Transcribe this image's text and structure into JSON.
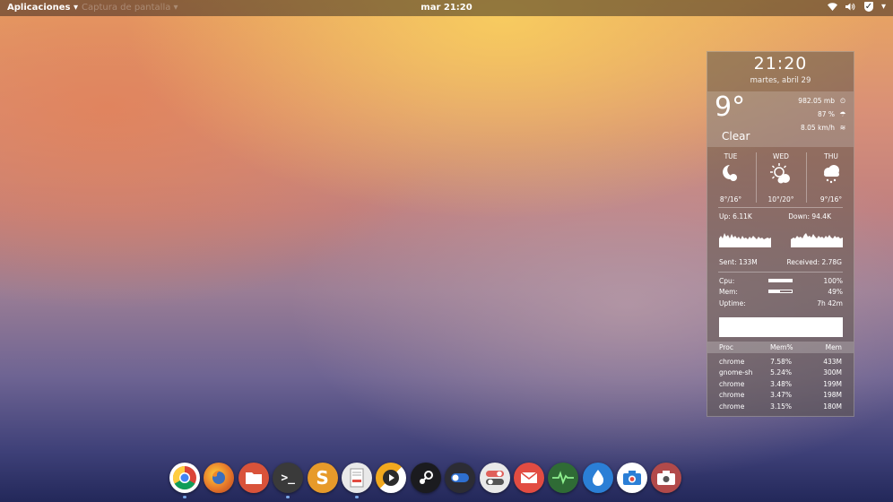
{
  "topbar": {
    "apps_menu": "Aplicaciones ▾",
    "capture_menu": "Captura de pantalla ▾",
    "clock": "mar 21:20",
    "tray_icons": [
      "wifi-icon",
      "volume-icon",
      "shield-check-icon",
      "chevron-down-icon"
    ]
  },
  "conky": {
    "time": "21:20",
    "date": "martes, abril 29",
    "weather": {
      "temp": "9°",
      "condition": "Clear",
      "pressure": "982.05 mb",
      "humidity": "87 %",
      "wind": "8.05 km/h",
      "forecast": [
        {
          "day": "TUE",
          "icon": "moon-cloud-icon",
          "range": "8°/16°"
        },
        {
          "day": "WED",
          "icon": "sun-cloud-icon",
          "range": "10°/20°"
        },
        {
          "day": "THU",
          "icon": "rain-cloud-icon",
          "range": "9°/16°"
        }
      ]
    },
    "network": {
      "up": "Up: 6.11K",
      "down": "Down: 94.4K",
      "sent": "Sent: 133M",
      "received": "Received: 2.78G"
    },
    "system": {
      "cpu_label": "Cpu:",
      "cpu_value": "100%",
      "cpu_fraction": 1.0,
      "mem_label": "Mem:",
      "mem_value": "49%",
      "mem_fraction": 0.49,
      "uptime_label": "Uptime:",
      "uptime_value": "7h 42m"
    },
    "processes": {
      "headers": [
        "Proc",
        "Mem%",
        "Mem"
      ],
      "rows": [
        [
          "chrome",
          "7.58%",
          "433M"
        ],
        [
          "gnome-sh",
          "5.24%",
          "300M"
        ],
        [
          "chrome",
          "3.48%",
          "199M"
        ],
        [
          "chrome",
          "3.47%",
          "198M"
        ],
        [
          "chrome",
          "3.15%",
          "180M"
        ]
      ]
    }
  },
  "dock": {
    "items": [
      {
        "name": "chrome",
        "color": "#ffffff"
      },
      {
        "name": "firefox",
        "color": "#e5762a"
      },
      {
        "name": "files",
        "color": "#d9533a"
      },
      {
        "name": "terminal",
        "color": "#3a3a3a"
      },
      {
        "name": "sublime-text",
        "color": "#e79a2a"
      },
      {
        "name": "text-editor",
        "color": "#e9e9e9"
      },
      {
        "name": "media-player",
        "color": "#f2a91e"
      },
      {
        "name": "steam",
        "color": "#1b1b1f"
      },
      {
        "name": "toggle-settings",
        "color": "#2c2c34"
      },
      {
        "name": "tweaks",
        "color": "#e0605a"
      },
      {
        "name": "mail",
        "color": "#e24c42"
      },
      {
        "name": "system-monitor",
        "color": "#2f6b35"
      },
      {
        "name": "water-drop",
        "color": "#2b7fd6"
      },
      {
        "name": "camera",
        "color": "#ffffff"
      },
      {
        "name": "screenshot",
        "color": "#b24a4a"
      }
    ]
  }
}
